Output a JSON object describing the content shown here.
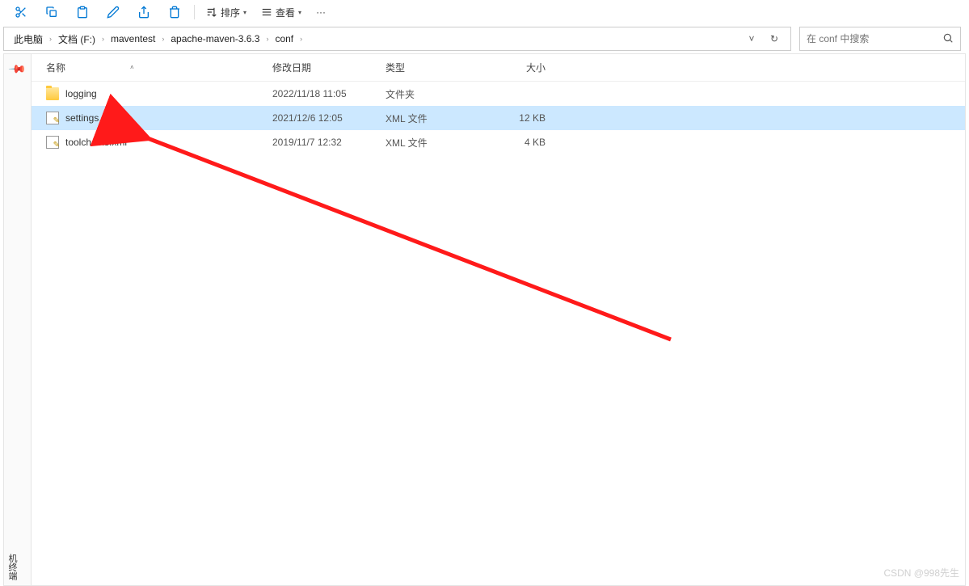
{
  "toolbar": {
    "sort_label": "排序",
    "view_label": "查看",
    "more_label": "···"
  },
  "breadcrumbs": {
    "items": [
      "此电脑",
      "文档 (F:)",
      "maventest",
      "apache-maven-3.6.3",
      "conf"
    ],
    "dropdown_chevron": "˅",
    "refresh": "↻"
  },
  "search": {
    "placeholder": "在 conf 中搜索"
  },
  "columns": {
    "name": "名称",
    "date": "修改日期",
    "type": "类型",
    "size": "大小",
    "sort_indicator": "˄"
  },
  "files": [
    {
      "icon": "folder",
      "name": "logging",
      "date": "2022/11/18 11:05",
      "type": "文件夹",
      "size": "",
      "selected": false
    },
    {
      "icon": "xml",
      "name": "settings.xml",
      "date": "2021/12/6 12:05",
      "type": "XML 文件",
      "size": "12 KB",
      "selected": true
    },
    {
      "icon": "xml",
      "name": "toolchains.xml",
      "date": "2019/11/7 12:32",
      "type": "XML 文件",
      "size": "4 KB",
      "selected": false
    }
  ],
  "sidebar": {
    "terminal_label": "机终端"
  },
  "watermark": "CSDN @998先生"
}
